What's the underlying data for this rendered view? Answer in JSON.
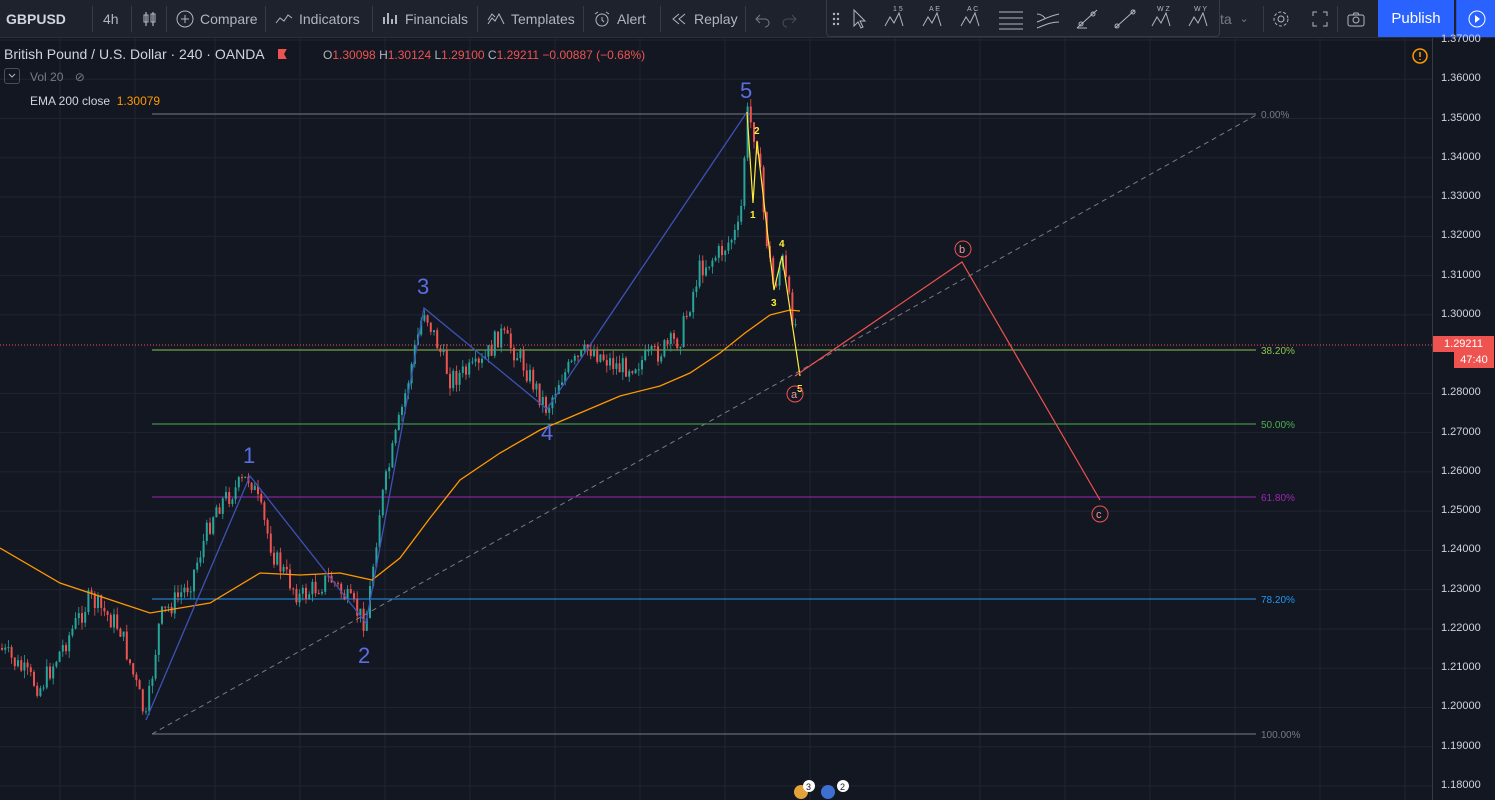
{
  "toolbar": {
    "symbol": "GBPUSD",
    "interval": "4h",
    "compare": "Compare",
    "indicators": "Indicators",
    "financials": "Financials",
    "templates": "Templates",
    "alert": "Alert",
    "replay": "Replay",
    "data_window_partial": "ta",
    "publish": "Publish"
  },
  "draw_tools": [
    "cursor-icon",
    "elliott-impulse-icon",
    "elliott-triangle-icon",
    "elliott-correction-icon",
    "fib-retracement-icon",
    "pitchfork-icon",
    "trend-angle-icon",
    "trend-line-icon",
    "elliott-double-combo-icon",
    "elliott-triple-combo-icon"
  ],
  "legend": {
    "title": "British Pound / U.S. Dollar · 240 · OANDA",
    "open_label": "O",
    "open": "1.30098",
    "high_label": "H",
    "high": "1.30124",
    "low_label": "L",
    "low": "1.29100",
    "close_label": "C",
    "close": "1.29211",
    "change": "−0.00887 (−0.68%)",
    "vol": "Vol 20",
    "ema_label": "EMA 200 close",
    "ema_value": "1.30079"
  },
  "price_axis": {
    "ticks": [
      "1.37000",
      "1.36000",
      "1.35000",
      "1.34000",
      "1.33000",
      "1.32000",
      "1.31000",
      "1.30000",
      "1.28000",
      "1.27000",
      "1.26000",
      "1.25000",
      "1.24000",
      "1.23000",
      "1.22000",
      "1.21000",
      "1.20000",
      "1.19000",
      "1.18000"
    ],
    "current_price": "1.29211",
    "countdown": "47:40"
  },
  "fib_levels": [
    {
      "label": "0.00%",
      "color": "#787b86"
    },
    {
      "label": "38.20%",
      "color": "#8bc34a"
    },
    {
      "label": "50.00%",
      "color": "#4caf50"
    },
    {
      "label": "61.80%",
      "color": "#9c27b0"
    },
    {
      "label": "78.20%",
      "color": "#2196f3"
    },
    {
      "label": "100.00%",
      "color": "#787b86"
    }
  ],
  "wave_labels": {
    "major": [
      "1",
      "2",
      "3",
      "4",
      "5"
    ],
    "minor": [
      "1",
      "2",
      "3",
      "4",
      "5"
    ],
    "corrective": [
      "a",
      "b",
      "c"
    ]
  },
  "bottom_badges": [
    "3",
    "2"
  ],
  "colors": {
    "up": "#26a69a",
    "down": "#ef5350",
    "ema": "#ff9800",
    "wave": "#3f51b5",
    "minor": "#ffeb3b",
    "correction": "#ef5350",
    "accent": "#2962ff"
  }
}
